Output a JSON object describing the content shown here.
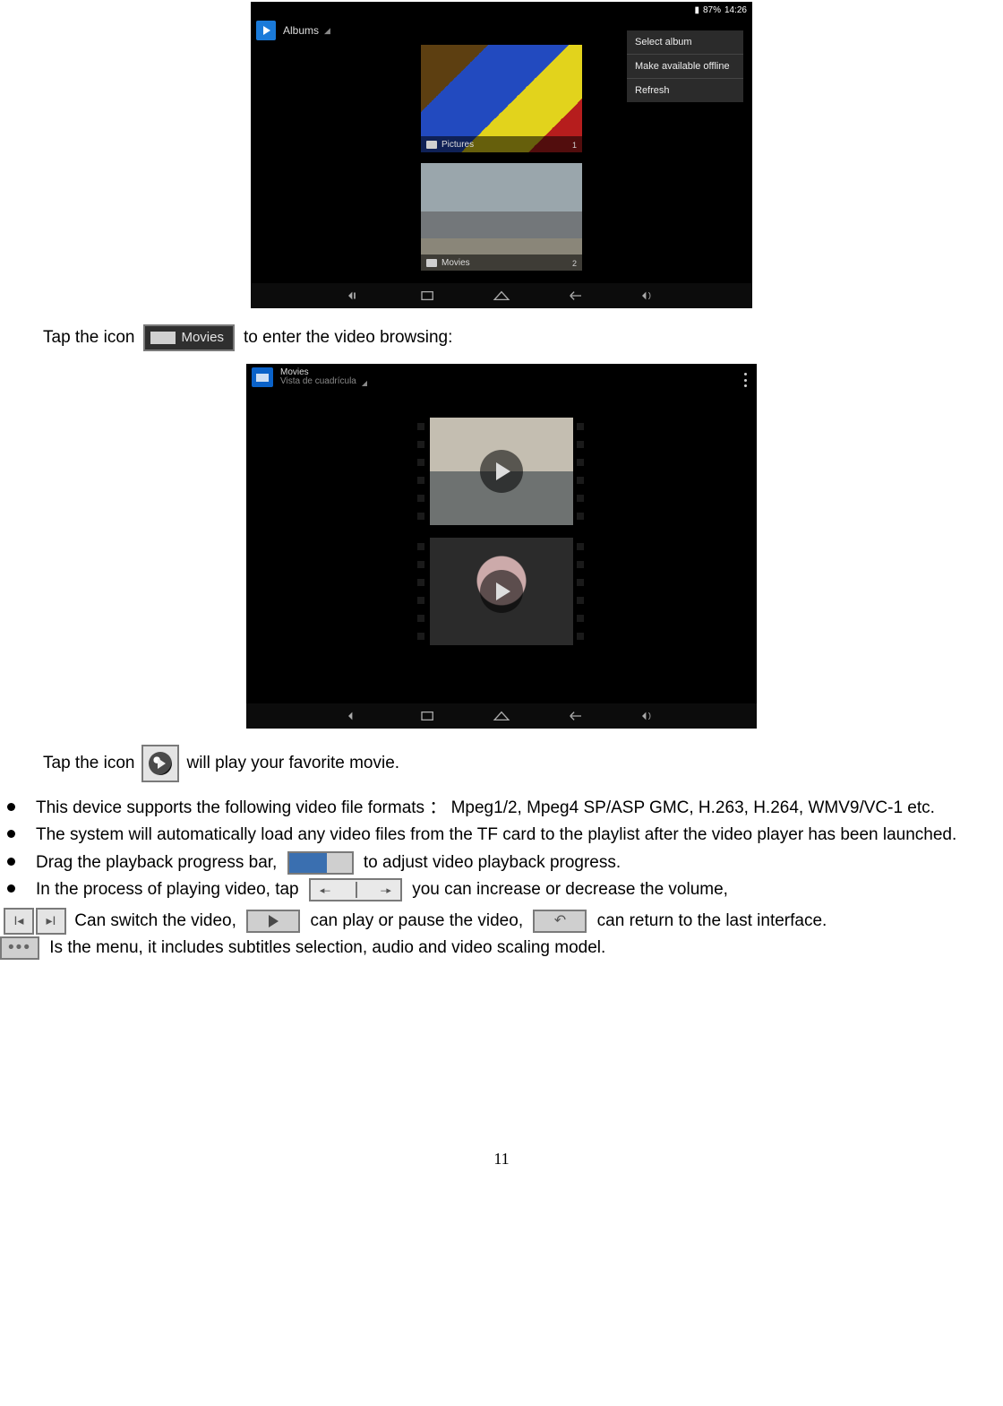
{
  "shot1": {
    "status": {
      "battery_pct": "87%",
      "time": "14:26"
    },
    "app_title": "Albums",
    "menu": [
      "Select album",
      "Make available offline",
      "Refresh"
    ],
    "albums": [
      {
        "label": "Pictures",
        "count": "1"
      },
      {
        "label": "Movies",
        "count": "2"
      }
    ]
  },
  "line1": {
    "pre": "Tap the icon",
    "badge_label": "Movies",
    "post": "to enter the video browsing:"
  },
  "shot2": {
    "title_line1": "Movies",
    "title_line2": "Vista de cuadrícula"
  },
  "line2": {
    "pre": "Tap the icon",
    "post": "will play your favorite movie."
  },
  "bullets": {
    "formats": "This device supports the following video file formats ： Mpeg1/2, Mpeg4 SP/ASP GMC, H.263, H.264, WMV9/VC-1 etc.",
    "autoload": "The system will automatically load any video files from the TF card to the playlist after the video player has been launched.",
    "drag_pre": "Drag the playback progress bar,",
    "drag_post": "to adjust video playback progress.",
    "vol_pre": "In the process of playing video, tap",
    "vol_post": "you can increase or decrease the volume,"
  },
  "tail": {
    "switch": "Can switch the video,",
    "play": "can play or pause the video,",
    "back": "can return to the last interface.",
    "menu": "Is the menu, it includes subtitles selection, audio and video scaling model."
  },
  "page_number": "11"
}
